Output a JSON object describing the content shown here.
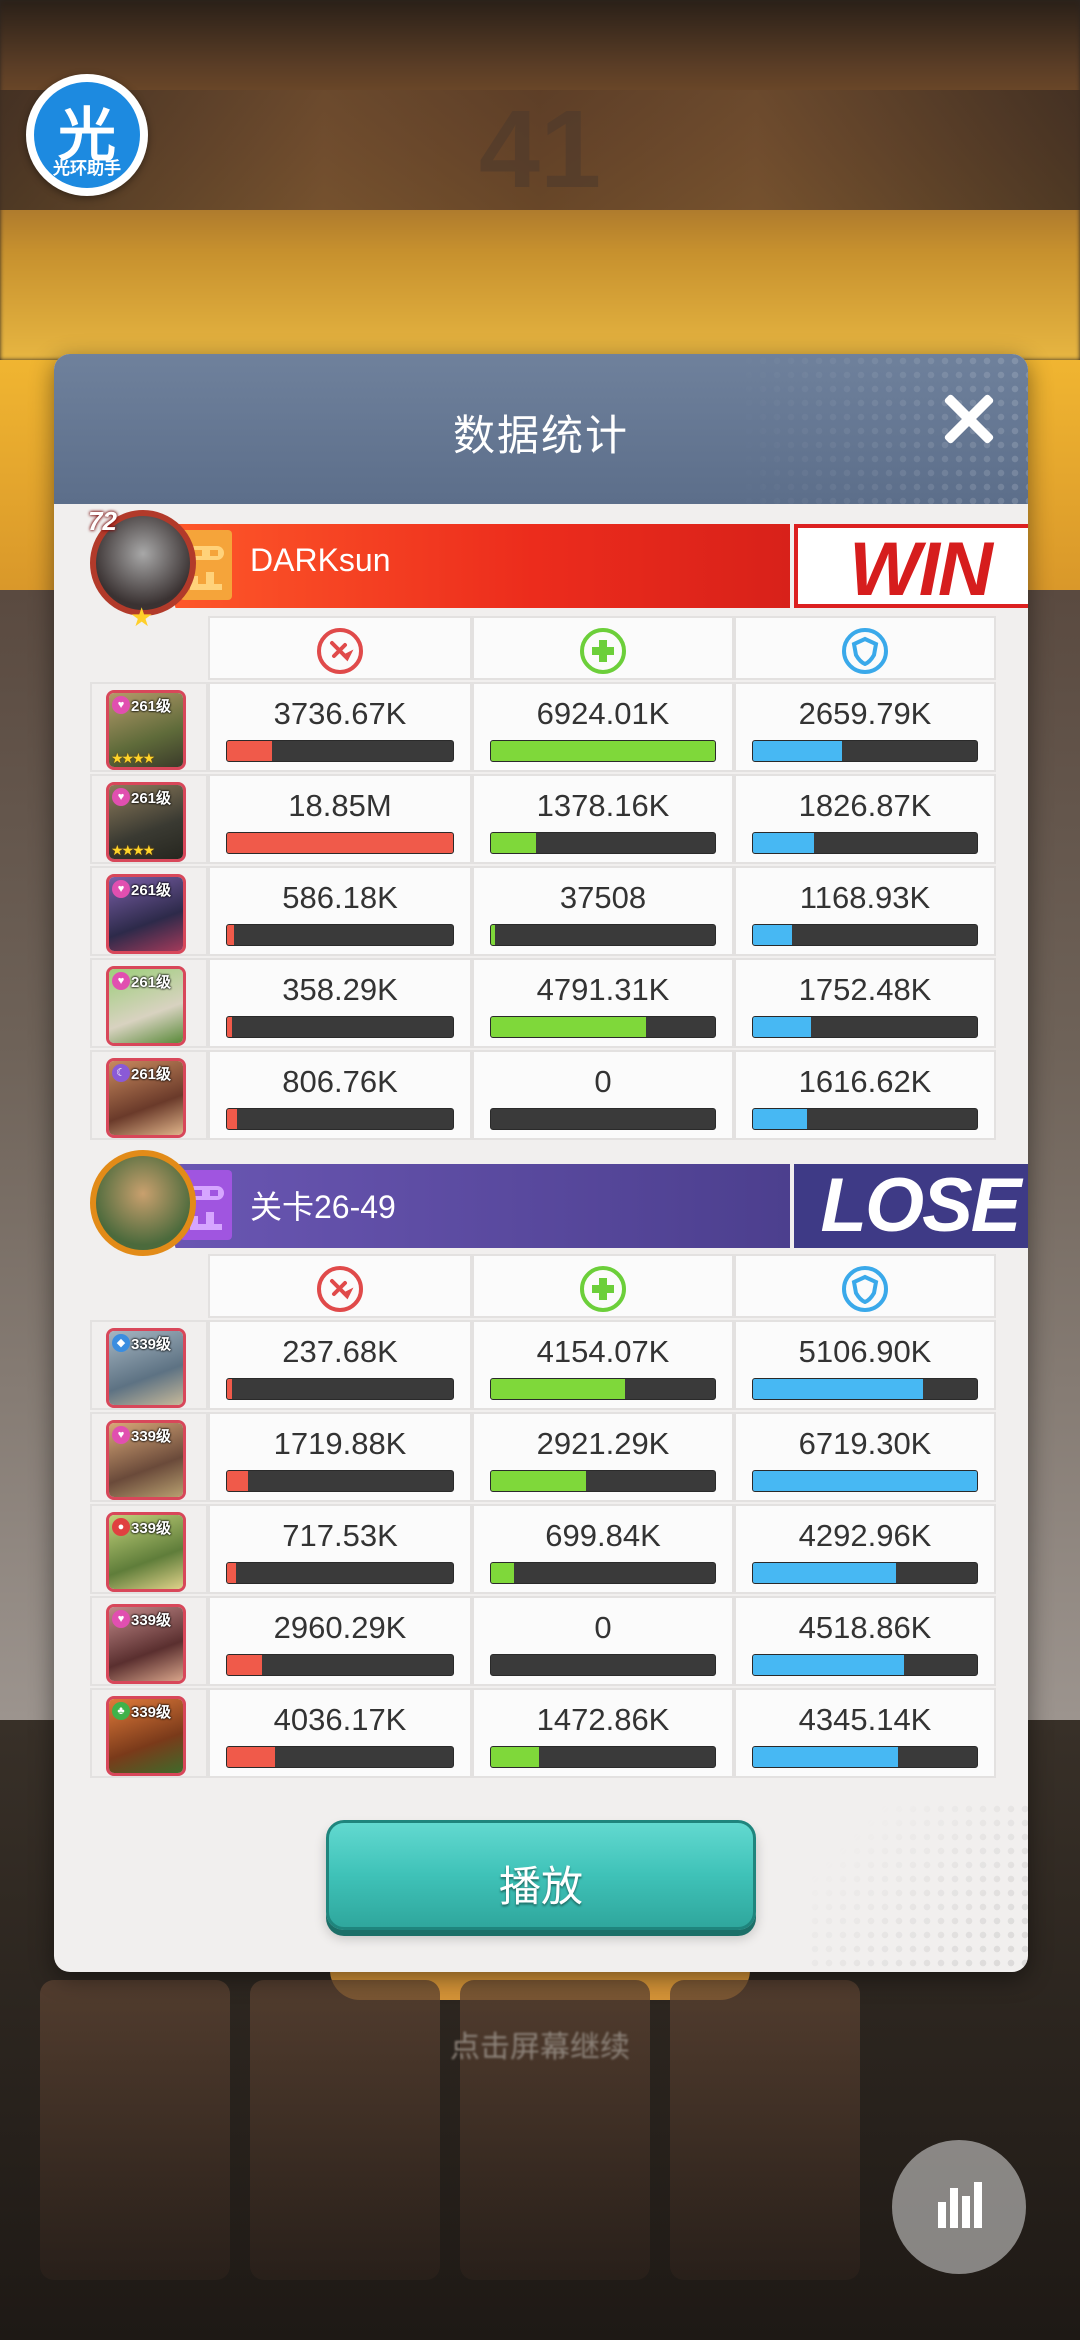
{
  "background": {
    "score": "41",
    "tip": "点击屏幕继续"
  },
  "badge": {
    "glyph": "光",
    "label": "光环助手"
  },
  "dialog": {
    "title": "数据统计",
    "play_label": "播放"
  },
  "stat_headers": [
    "attack-icon",
    "heal-icon",
    "defense-icon"
  ],
  "colors": {
    "attack": "#f05a4a",
    "heal": "#7fd83a",
    "defense": "#47b8f3",
    "play": "#3fc2b8"
  },
  "team_win": {
    "player_level": "72",
    "name": "DARKsun",
    "result": "WIN",
    "heroes": [
      {
        "level": "261级",
        "element": "♥",
        "element_color": "#e14fb0",
        "stars": "★★★★",
        "damage": "3736.67K",
        "damage_ratio": 0.198,
        "heal": "6924.01K",
        "heal_ratio": 1.0,
        "defense": "2659.79K",
        "defense_ratio": 0.396
      },
      {
        "level": "261级",
        "element": "♥",
        "element_color": "#e14fb0",
        "stars": "★★★★",
        "damage": "18.85M",
        "damage_ratio": 1.0,
        "heal": "1378.16K",
        "heal_ratio": 0.199,
        "defense": "1826.87K",
        "defense_ratio": 0.272
      },
      {
        "level": "261级",
        "element": "♥",
        "element_color": "#e14fb0",
        "stars": "",
        "damage": "586.18K",
        "damage_ratio": 0.031,
        "heal": "37508",
        "heal_ratio": 0.005,
        "defense": "1168.93K",
        "defense_ratio": 0.174
      },
      {
        "level": "261级",
        "element": "♥",
        "element_color": "#e14fb0",
        "stars": "",
        "damage": "358.29K",
        "damage_ratio": 0.019,
        "heal": "4791.31K",
        "heal_ratio": 0.692,
        "defense": "1752.48K",
        "defense_ratio": 0.261
      },
      {
        "level": "261级",
        "element": "☾",
        "element_color": "#8a5ad6",
        "stars": "",
        "damage": "806.76K",
        "damage_ratio": 0.043,
        "heal": "0",
        "heal_ratio": 0.0,
        "defense": "1616.62K",
        "defense_ratio": 0.241
      }
    ]
  },
  "team_lose": {
    "name": "关卡26-49",
    "result": "LOSE",
    "heroes": [
      {
        "level": "339级",
        "element": "◆",
        "element_color": "#3a8de0",
        "stars": "",
        "damage": "237.68K",
        "damage_ratio": 0.013,
        "heal": "4154.07K",
        "heal_ratio": 0.6,
        "defense": "5106.90K",
        "defense_ratio": 0.76
      },
      {
        "level": "339级",
        "element": "♥",
        "element_color": "#e14fb0",
        "stars": "",
        "damage": "1719.88K",
        "damage_ratio": 0.091,
        "heal": "2921.29K",
        "heal_ratio": 0.422,
        "defense": "6719.30K",
        "defense_ratio": 1.0
      },
      {
        "level": "339级",
        "element": "●",
        "element_color": "#e04040",
        "stars": "",
        "damage": "717.53K",
        "damage_ratio": 0.038,
        "heal": "699.84K",
        "heal_ratio": 0.101,
        "defense": "4292.96K",
        "defense_ratio": 0.639
      },
      {
        "level": "339级",
        "element": "♥",
        "element_color": "#e14fb0",
        "stars": "",
        "damage": "2960.29K",
        "damage_ratio": 0.157,
        "heal": "0",
        "heal_ratio": 0.0,
        "defense": "4518.86K",
        "defense_ratio": 0.672
      },
      {
        "level": "339级",
        "element": "♣",
        "element_color": "#3fb24a",
        "stars": "",
        "damage": "4036.17K",
        "damage_ratio": 0.214,
        "heal": "1472.86K",
        "heal_ratio": 0.213,
        "defense": "4345.14K",
        "defense_ratio": 0.647
      }
    ]
  }
}
